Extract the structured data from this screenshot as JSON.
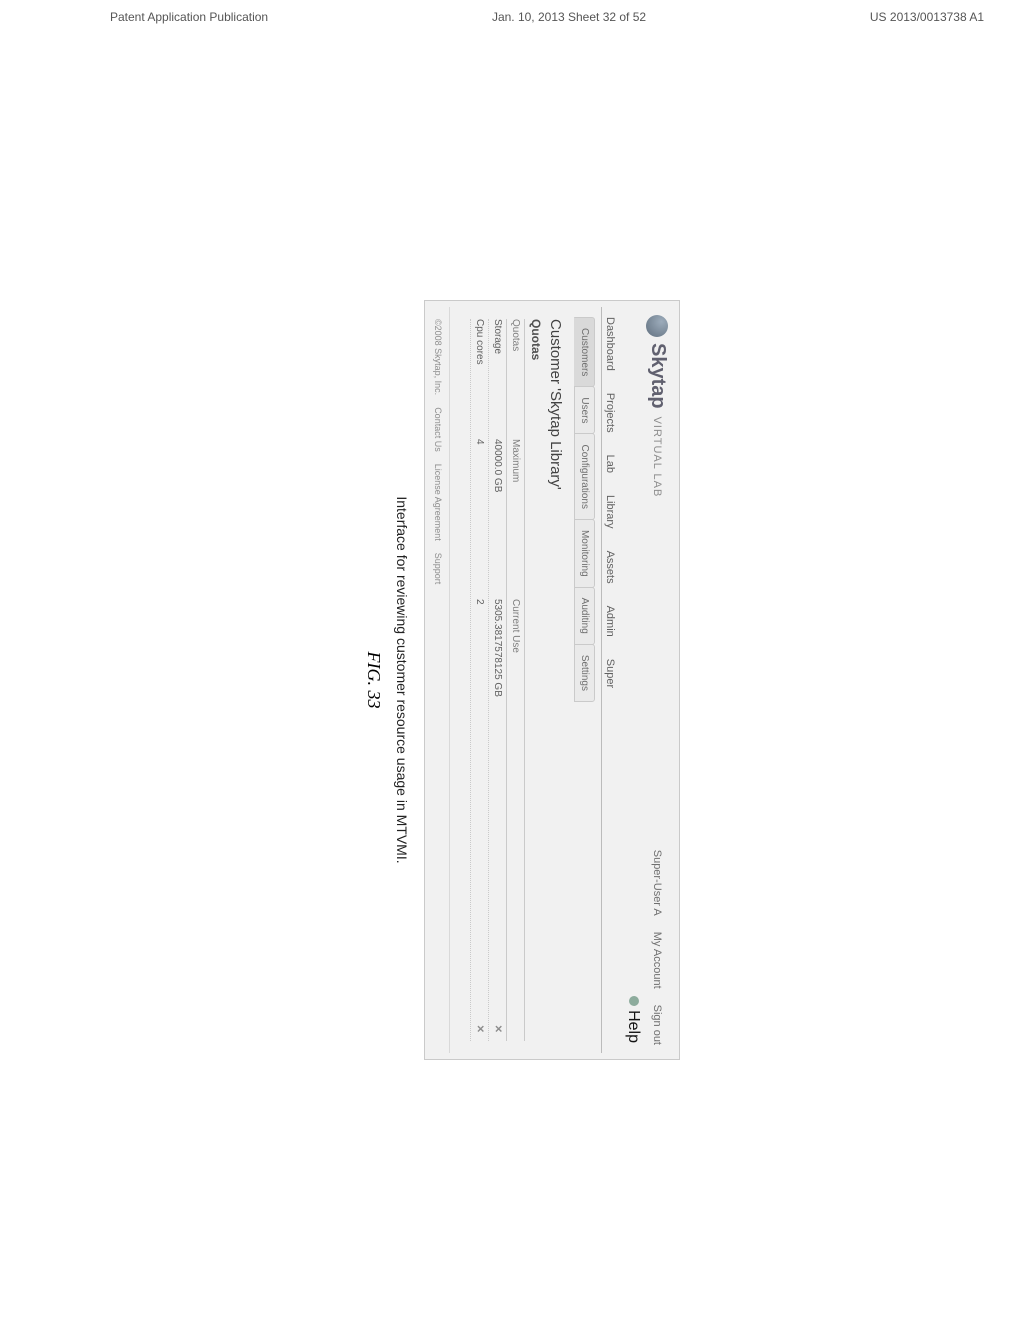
{
  "page_header": {
    "left": "Patent Application Publication",
    "center": "Jan. 10, 2013  Sheet 32 of 52",
    "right": "US 2013/0013738 A1"
  },
  "brand": {
    "name": "Skytap",
    "sub": "VIRTUAL LAB"
  },
  "topbar": {
    "user": "Super-User A",
    "my_account": "My Account",
    "sign_out": "Sign out",
    "help": "Help"
  },
  "main_tabs": [
    "Dashboard",
    "Projects",
    "Lab",
    "Library",
    "Assets",
    "Admin",
    "Super"
  ],
  "sub_tabs": [
    "Customers",
    "Users",
    "Configurations",
    "Monitoring",
    "Auditing",
    "Settings"
  ],
  "section_title": "Customer 'Skytap Library'",
  "subsection_title": "Quotas",
  "quota_table": {
    "headers": {
      "name": "Quotas",
      "max": "Maximum",
      "cur": "Current Use"
    },
    "rows": [
      {
        "name": "Storage",
        "max": "40000.0 GB",
        "cur": "5305.3817578125 GB",
        "deletable": true
      },
      {
        "name": "Cpu cores",
        "max": "4",
        "cur": "2",
        "deletable": true
      }
    ]
  },
  "footer": {
    "copyright": "©2008 Skytap, Inc.",
    "links": [
      "Contact Us",
      "License Agreement",
      "Support"
    ]
  },
  "caption": "Interface for reviewing customer resource usage in MTVMI.",
  "fig": "FIG. 33"
}
